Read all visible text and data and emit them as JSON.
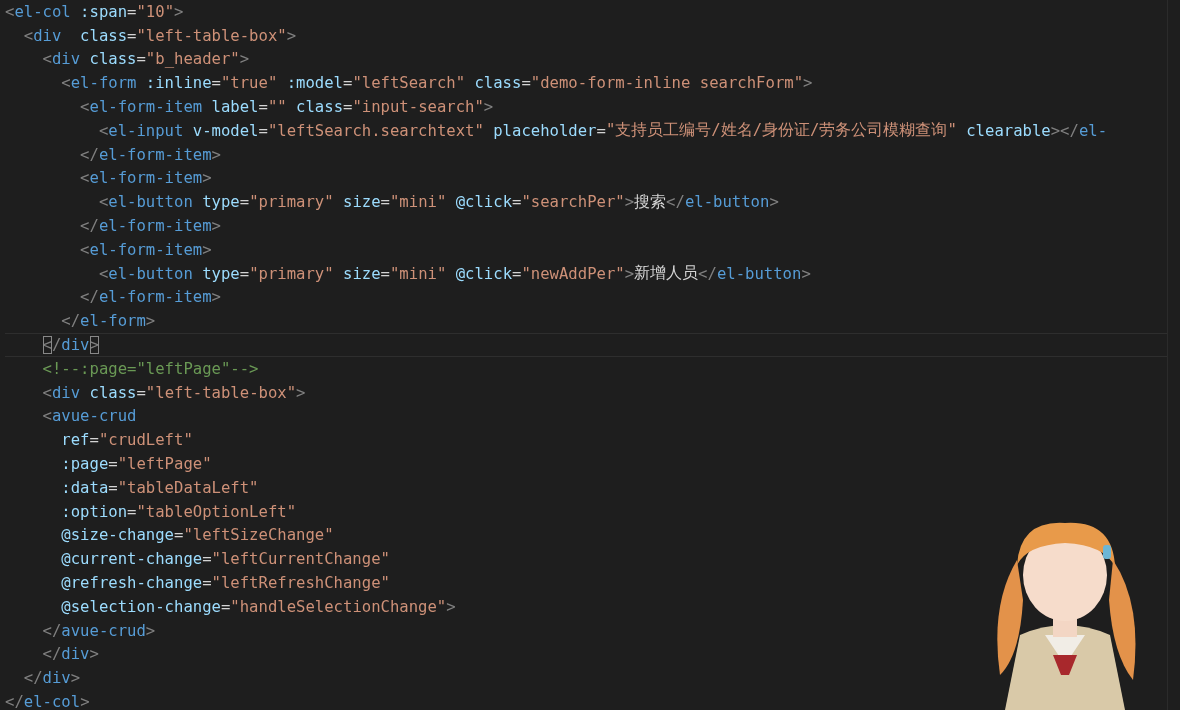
{
  "editor": {
    "lines": [
      {
        "selected": false,
        "tokens": [
          {
            "kind": "punct",
            "text": "<"
          },
          {
            "kind": "tag",
            "text": "el-col"
          },
          {
            "kind": "attr",
            "text": " :span"
          },
          {
            "kind": "plain",
            "text": "="
          },
          {
            "kind": "string",
            "text": "\"10\""
          },
          {
            "kind": "punct",
            "text": ">"
          }
        ]
      },
      {
        "selected": false,
        "tokens": [
          {
            "kind": "punct",
            "text": "  <"
          },
          {
            "kind": "tag",
            "text": "div"
          },
          {
            "kind": "attr",
            "text": "  class"
          },
          {
            "kind": "plain",
            "text": "="
          },
          {
            "kind": "string",
            "text": "\"left-table-box\""
          },
          {
            "kind": "punct",
            "text": ">"
          }
        ]
      },
      {
        "selected": false,
        "tokens": [
          {
            "kind": "punct",
            "text": "    <"
          },
          {
            "kind": "tag",
            "text": "div"
          },
          {
            "kind": "attr",
            "text": " class"
          },
          {
            "kind": "plain",
            "text": "="
          },
          {
            "kind": "string",
            "text": "\"b_header\""
          },
          {
            "kind": "punct",
            "text": ">"
          }
        ]
      },
      {
        "selected": false,
        "tokens": [
          {
            "kind": "punct",
            "text": "      <"
          },
          {
            "kind": "tag",
            "text": "el-form"
          },
          {
            "kind": "attr",
            "text": " :inline"
          },
          {
            "kind": "plain",
            "text": "="
          },
          {
            "kind": "string",
            "text": "\"true\""
          },
          {
            "kind": "attr",
            "text": " :model"
          },
          {
            "kind": "plain",
            "text": "="
          },
          {
            "kind": "string",
            "text": "\"leftSearch\""
          },
          {
            "kind": "attr",
            "text": " class"
          },
          {
            "kind": "plain",
            "text": "="
          },
          {
            "kind": "string",
            "text": "\"demo-form-inline searchForm\""
          },
          {
            "kind": "punct",
            "text": ">"
          }
        ]
      },
      {
        "selected": false,
        "tokens": [
          {
            "kind": "punct",
            "text": "        <"
          },
          {
            "kind": "tag",
            "text": "el-form-item"
          },
          {
            "kind": "attr",
            "text": " label"
          },
          {
            "kind": "plain",
            "text": "="
          },
          {
            "kind": "string",
            "text": "\"\""
          },
          {
            "kind": "attr",
            "text": " class"
          },
          {
            "kind": "plain",
            "text": "="
          },
          {
            "kind": "string",
            "text": "\"input-search\""
          },
          {
            "kind": "punct",
            "text": ">"
          }
        ]
      },
      {
        "selected": false,
        "tokens": [
          {
            "kind": "punct",
            "text": "          <"
          },
          {
            "kind": "tag",
            "text": "el-input"
          },
          {
            "kind": "attr",
            "text": " v-model"
          },
          {
            "kind": "plain",
            "text": "="
          },
          {
            "kind": "string",
            "text": "\"leftSearch.searchtext\""
          },
          {
            "kind": "attr",
            "text": " placeholder"
          },
          {
            "kind": "plain",
            "text": "="
          },
          {
            "kind": "string",
            "text": "\"支持员工编号/姓名/身份证/劳务公司模糊查询\""
          },
          {
            "kind": "attr",
            "text": " clearable"
          },
          {
            "kind": "punct",
            "text": "></"
          },
          {
            "kind": "tag",
            "text": "el-"
          }
        ]
      },
      {
        "selected": false,
        "tokens": [
          {
            "kind": "punct",
            "text": "        </"
          },
          {
            "kind": "tag",
            "text": "el-form-item"
          },
          {
            "kind": "punct",
            "text": ">"
          }
        ]
      },
      {
        "selected": false,
        "tokens": [
          {
            "kind": "punct",
            "text": "        <"
          },
          {
            "kind": "tag",
            "text": "el-form-item"
          },
          {
            "kind": "punct",
            "text": ">"
          }
        ]
      },
      {
        "selected": false,
        "tokens": [
          {
            "kind": "punct",
            "text": "          <"
          },
          {
            "kind": "tag",
            "text": "el-button"
          },
          {
            "kind": "attr",
            "text": " type"
          },
          {
            "kind": "plain",
            "text": "="
          },
          {
            "kind": "string",
            "text": "\"primary\""
          },
          {
            "kind": "attr",
            "text": " size"
          },
          {
            "kind": "plain",
            "text": "="
          },
          {
            "kind": "string",
            "text": "\"mini\""
          },
          {
            "kind": "attr",
            "text": " @click"
          },
          {
            "kind": "plain",
            "text": "="
          },
          {
            "kind": "string",
            "text": "\"searchPer\""
          },
          {
            "kind": "punct",
            "text": ">"
          },
          {
            "kind": "plain",
            "text": "搜索"
          },
          {
            "kind": "punct",
            "text": "</"
          },
          {
            "kind": "tag",
            "text": "el-button"
          },
          {
            "kind": "punct",
            "text": ">"
          }
        ]
      },
      {
        "selected": false,
        "tokens": [
          {
            "kind": "punct",
            "text": "        </"
          },
          {
            "kind": "tag",
            "text": "el-form-item"
          },
          {
            "kind": "punct",
            "text": ">"
          }
        ]
      },
      {
        "selected": false,
        "tokens": [
          {
            "kind": "punct",
            "text": "        <"
          },
          {
            "kind": "tag",
            "text": "el-form-item"
          },
          {
            "kind": "punct",
            "text": ">"
          }
        ]
      },
      {
        "selected": false,
        "tokens": [
          {
            "kind": "punct",
            "text": "          <"
          },
          {
            "kind": "tag",
            "text": "el-button"
          },
          {
            "kind": "attr",
            "text": " type"
          },
          {
            "kind": "plain",
            "text": "="
          },
          {
            "kind": "string",
            "text": "\"primary\""
          },
          {
            "kind": "attr",
            "text": " size"
          },
          {
            "kind": "plain",
            "text": "="
          },
          {
            "kind": "string",
            "text": "\"mini\""
          },
          {
            "kind": "attr",
            "text": " @click"
          },
          {
            "kind": "plain",
            "text": "="
          },
          {
            "kind": "string",
            "text": "\"newAddPer\""
          },
          {
            "kind": "punct",
            "text": ">"
          },
          {
            "kind": "plain",
            "text": "新增人员"
          },
          {
            "kind": "punct",
            "text": "</"
          },
          {
            "kind": "tag",
            "text": "el-button"
          },
          {
            "kind": "punct",
            "text": ">"
          }
        ]
      },
      {
        "selected": false,
        "tokens": [
          {
            "kind": "punct",
            "text": "        </"
          },
          {
            "kind": "tag",
            "text": "el-form-item"
          },
          {
            "kind": "punct",
            "text": ">"
          }
        ]
      },
      {
        "selected": false,
        "tokens": [
          {
            "kind": "punct",
            "text": "      </"
          },
          {
            "kind": "tag",
            "text": "el-form"
          },
          {
            "kind": "punct",
            "text": ">"
          }
        ]
      },
      {
        "selected": true,
        "tokens": [
          {
            "kind": "match",
            "text": "    <"
          },
          {
            "kind": "punct",
            "text": "/"
          },
          {
            "kind": "tag",
            "text": "div"
          },
          {
            "kind": "match",
            "text": ">"
          }
        ]
      },
      {
        "selected": false,
        "tokens": [
          {
            "kind": "comment",
            "text": "    <!--:page=\"leftPage\"-->"
          }
        ]
      },
      {
        "selected": false,
        "tokens": [
          {
            "kind": "punct",
            "text": "    <"
          },
          {
            "kind": "tag",
            "text": "div"
          },
          {
            "kind": "attr",
            "text": " class"
          },
          {
            "kind": "plain",
            "text": "="
          },
          {
            "kind": "string",
            "text": "\"left-table-box\""
          },
          {
            "kind": "punct",
            "text": ">"
          }
        ]
      },
      {
        "selected": false,
        "tokens": [
          {
            "kind": "punct",
            "text": "    <"
          },
          {
            "kind": "tag",
            "text": "avue-crud"
          }
        ]
      },
      {
        "selected": false,
        "tokens": [
          {
            "kind": "attr",
            "text": "      ref"
          },
          {
            "kind": "plain",
            "text": "="
          },
          {
            "kind": "string",
            "text": "\"crudLeft\""
          }
        ]
      },
      {
        "selected": false,
        "tokens": [
          {
            "kind": "attr",
            "text": "      :page"
          },
          {
            "kind": "plain",
            "text": "="
          },
          {
            "kind": "string",
            "text": "\"leftPage\""
          }
        ]
      },
      {
        "selected": false,
        "tokens": [
          {
            "kind": "attr",
            "text": "      :data"
          },
          {
            "kind": "plain",
            "text": "="
          },
          {
            "kind": "string",
            "text": "\"tableDataLeft\""
          }
        ]
      },
      {
        "selected": false,
        "tokens": [
          {
            "kind": "attr",
            "text": "      :option"
          },
          {
            "kind": "plain",
            "text": "="
          },
          {
            "kind": "string",
            "text": "\"tableOptionLeft\""
          }
        ]
      },
      {
        "selected": false,
        "tokens": [
          {
            "kind": "attr",
            "text": "      @size-change"
          },
          {
            "kind": "plain",
            "text": "="
          },
          {
            "kind": "string",
            "text": "\"leftSizeChange\""
          }
        ]
      },
      {
        "selected": false,
        "tokens": [
          {
            "kind": "attr",
            "text": "      @current-change"
          },
          {
            "kind": "plain",
            "text": "="
          },
          {
            "kind": "string",
            "text": "\"leftCurrentChange\""
          }
        ]
      },
      {
        "selected": false,
        "tokens": [
          {
            "kind": "attr",
            "text": "      @refresh-change"
          },
          {
            "kind": "plain",
            "text": "="
          },
          {
            "kind": "string",
            "text": "\"leftRefreshChange\""
          }
        ]
      },
      {
        "selected": false,
        "tokens": [
          {
            "kind": "attr",
            "text": "      @selection-change"
          },
          {
            "kind": "plain",
            "text": "="
          },
          {
            "kind": "string",
            "text": "\"handleSelectionChange\""
          },
          {
            "kind": "punct",
            "text": ">"
          }
        ]
      },
      {
        "selected": false,
        "tokens": [
          {
            "kind": "punct",
            "text": "    </"
          },
          {
            "kind": "tag",
            "text": "avue-crud"
          },
          {
            "kind": "punct",
            "text": ">"
          }
        ]
      },
      {
        "selected": false,
        "tokens": [
          {
            "kind": "punct",
            "text": "    </"
          },
          {
            "kind": "tag",
            "text": "div"
          },
          {
            "kind": "punct",
            "text": ">"
          }
        ]
      },
      {
        "selected": false,
        "tokens": [
          {
            "kind": "punct",
            "text": "  </"
          },
          {
            "kind": "tag",
            "text": "div"
          },
          {
            "kind": "punct",
            "text": ">"
          }
        ]
      },
      {
        "selected": false,
        "tokens": [
          {
            "kind": "punct",
            "text": "</"
          },
          {
            "kind": "tag",
            "text": "el-col"
          },
          {
            "kind": "punct",
            "text": ">"
          }
        ]
      }
    ]
  }
}
